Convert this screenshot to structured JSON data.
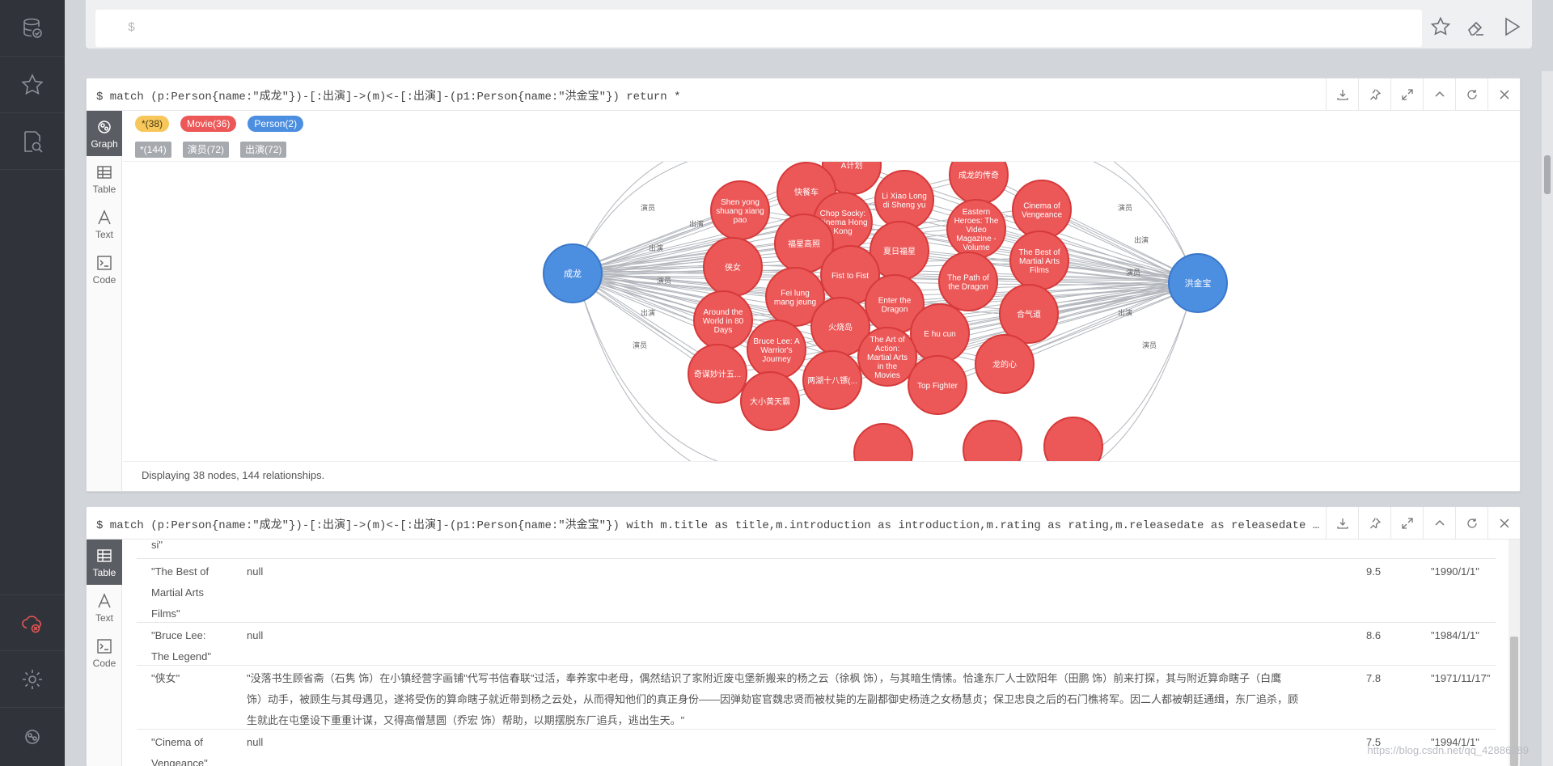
{
  "app": {
    "editor_prompt": "$"
  },
  "graph_frame": {
    "query": "$ match (p:Person{name:\"成龙\"})-[:出演]->(m)<-[:出演]-(p1:Person{name:\"洪金宝\"}) return *",
    "tabs": [
      "Graph",
      "Table",
      "Text",
      "Code"
    ],
    "node_labels": [
      {
        "text": "*(38)"
      },
      {
        "text": "Movie(36)"
      },
      {
        "text": "Person(2)"
      }
    ],
    "rel_types": [
      {
        "text": "*(144)"
      },
      {
        "text": "演员(72)"
      },
      {
        "text": "出演(72)"
      }
    ],
    "persons": [
      "成龙",
      "洪金宝"
    ],
    "movies": [
      "A计划",
      "成龙的传奇",
      "快餐车",
      "Li Xiao Long di Sheng yu",
      "Shen yong shuang xiang pao",
      "Chop Socky: Cinema Hong Kong",
      "Cinema of Vengeance",
      "Eastern Heroes: The Video Magazine - Volume",
      "福星高照",
      "夏日福星",
      "The Best of Martial Arts Films",
      "侠女",
      "Fist to Fist",
      "The Path of the Dragon",
      "Fei lung mang jeung",
      "Enter the Dragon",
      "合气道",
      "Around the World in 80 Days",
      "火烧岛",
      "E hu cun",
      "Bruce Lee: A Warrior's Journey",
      "The Art of Action: Martial Arts in the Movies",
      "龙的心",
      "奇谋妙计五...",
      "两湖十八镖(...",
      "Top Fighter",
      "大小黄天霸"
    ],
    "edge_label_out": "出演",
    "edge_label_in": "演员",
    "status": "Displaying 38 nodes, 144 relationships.",
    "colors": {
      "person": "#4c8ee0",
      "movie": "#ec5757",
      "movie_border": "#d63a3a",
      "edge": "#b3b7bd"
    }
  },
  "table_frame": {
    "query": "$ match (p:Person{name:\"成龙\"})-[:出演]->(m)<-[:出演]-(p1:Person{name:\"洪金宝\"}) with m.title as title,m.introduction as introduction,m.rating as rating,m.releasedate as releasedate  return ti...",
    "tabs": [
      "Table",
      "Text",
      "Code"
    ],
    "partial_top": "si\"",
    "rows": [
      {
        "title": "\"The Best of Martial Arts Films\"",
        "introduction": "null",
        "rating": "9.5",
        "releasedate": "\"1990/1/1\""
      },
      {
        "title": "\"Bruce Lee: The Legend\"",
        "introduction": "null",
        "rating": "8.6",
        "releasedate": "\"1984/1/1\""
      },
      {
        "title": "\"侠女\"",
        "introduction": "\"没落书生顾省斋（石隽 饰）在小镇经营字画铺\"代写书信春联\"过活，奉养家中老母，偶然结识了家附近废屯堡新搬来的杨之云（徐枫 饰），与其暗生情愫。恰逢东厂人士欧阳年（田鹏 饰）前来打探，其与附近算命瞎子（白鹰 饰）动手，被顾生与其母遇见，遂将受伤的算命瞎子就近带到杨之云处，从而得知他们的真正身份——因弹劾宦官魏忠贤而被杖毙的左副都御史杨涟之女杨慧贞；保卫忠良之后的石门樵将军。因二人都被朝廷通缉，东厂追杀，顾生就此在屯堡设下重重计谋，又得高僧慧圆（乔宏 饰）帮助，以期摆脱东厂追兵，逃出生天。\"",
        "rating": "7.8",
        "releasedate": "\"1971/11/17\""
      },
      {
        "title": "\"Cinema of Vengeance\"",
        "introduction": "null",
        "rating": "7.5",
        "releasedate": "\"1994/1/1\""
      }
    ]
  },
  "watermark": "https://blog.csdn.net/qq_42886289"
}
